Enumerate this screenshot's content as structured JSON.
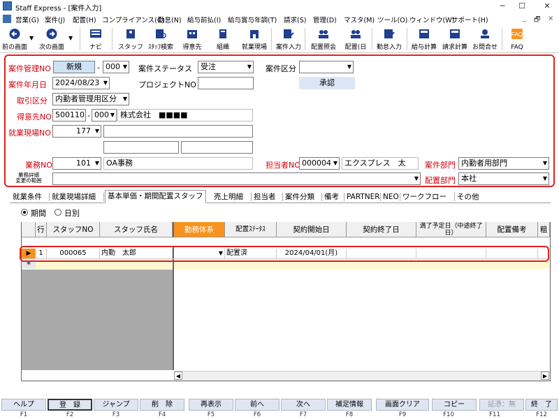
{
  "window": {
    "title": "Staff Express - [案件入力]",
    "min": "─",
    "max": "☐",
    "close": "✕",
    "child_min": "_",
    "child_restore": "🗗",
    "child_close": "×"
  },
  "menu": [
    "営業(G)",
    "案件(J)",
    "配置(H)",
    "コンプライアンス(C)",
    "勤怠(N)",
    "給与前払(I)",
    "給与賞与年調(T)",
    "請求(S)",
    "管理(D)",
    "マスタ(M)",
    "ツール(O)",
    "ウィンドウ(W)",
    "サポート(H)"
  ],
  "toolbar": {
    "back": "前の画面",
    "forward": "次の画面",
    "navi": "ナビ",
    "staff": "スタッフ",
    "staff_search": "ｽﾀｯﾌ検索",
    "client": "得意先",
    "org": "組織",
    "site": "就業現場",
    "case_input": "案件入力",
    "placement_inquiry": "配置照会",
    "placement_day": "配置(日",
    "attendance_input": "勤怠入力",
    "payroll": "給与計算",
    "billing": "請求計算",
    "contact": "お問合せ",
    "faq": "FAQ"
  },
  "form": {
    "case_no_label": "案件管理NO",
    "case_no_value": "新規",
    "case_no_sub": "000",
    "case_status_label": "案件ステータス",
    "case_status_value": "受注",
    "case_type_label": "案件区分",
    "case_type_value": "",
    "case_date_label": "案件年月日",
    "case_date_value": "2024/08/23",
    "project_label": "プロジェクトNO",
    "project_value": "",
    "approve_label": "承認",
    "trade_label": "取引区分",
    "trade_value": "内勤者管理用区分",
    "client_label": "得意先NO",
    "client_no": "500110",
    "client_sub": "000",
    "client_name": "株式会社　■■■■",
    "site_label": "就業現場NO",
    "site_no": "177",
    "site_name": "",
    "site_extra1": "",
    "site_extra2": "",
    "job_label": "業務NO",
    "job_no": "101",
    "job_name": "OA事務",
    "person_label": "担当者NO",
    "person_no": "000004",
    "person_name": "エクスプレス　太",
    "dept_label": "案件部門",
    "dept_value": "内勤者用部門",
    "detail_label_1": "業務詳細",
    "detail_label_2": "変更の範囲",
    "detail_value": "",
    "assign_dept_label": "配置部門",
    "assign_dept_value": "本社"
  },
  "tabs": [
    "就業条件",
    "就業現場詳細",
    "基本単価・期間配置スタッフ",
    "売上明細",
    "担当者",
    "案件分類",
    "備考",
    "PARTNER",
    "NEO",
    "ワークフロー",
    "その他"
  ],
  "radio": {
    "period": "期間",
    "daily": "日別"
  },
  "grid": {
    "headers": [
      "行",
      "スタッフNO",
      "スタッフ氏名",
      "勤務体系",
      "配置ｽﾃｰﾀｽ",
      "契約開始日",
      "契約終了日",
      "満了予定日（中途終了日）",
      "配置備考",
      "粗"
    ],
    "row": {
      "line": "1",
      "staff_no": "000065",
      "staff_name": "内勤　太郎",
      "work_type": "",
      "status": "配置済",
      "start": "2024/04/01(月)",
      "end": "",
      "expire": "",
      "note": ""
    },
    "new_row_marker": "＊"
  },
  "fkeys": [
    {
      "label": "ヘルプ",
      "key": "F1"
    },
    {
      "label": "登　録",
      "key": "F2"
    },
    {
      "label": "ジャンプ",
      "key": "F3"
    },
    {
      "label": "削　除",
      "key": "F4"
    },
    {
      "label": "再表示",
      "key": "F5"
    },
    {
      "label": "前へ",
      "key": "F6"
    },
    {
      "label": "次へ",
      "key": "F7"
    },
    {
      "label": "補足情報",
      "key": "F8"
    },
    {
      "label": "画面クリア",
      "key": "F9"
    },
    {
      "label": "コピー",
      "key": "F10"
    },
    {
      "label": "証憑：無",
      "key": "F11"
    },
    {
      "label": "終　了",
      "key": "F12"
    }
  ],
  "colors": {
    "accent_red": "#e02020",
    "label_red": "#d4000d",
    "highlight_orange": "#f7931e",
    "new_blue": "#cfe3f7",
    "fkey_bg": "#dfe6f2"
  }
}
